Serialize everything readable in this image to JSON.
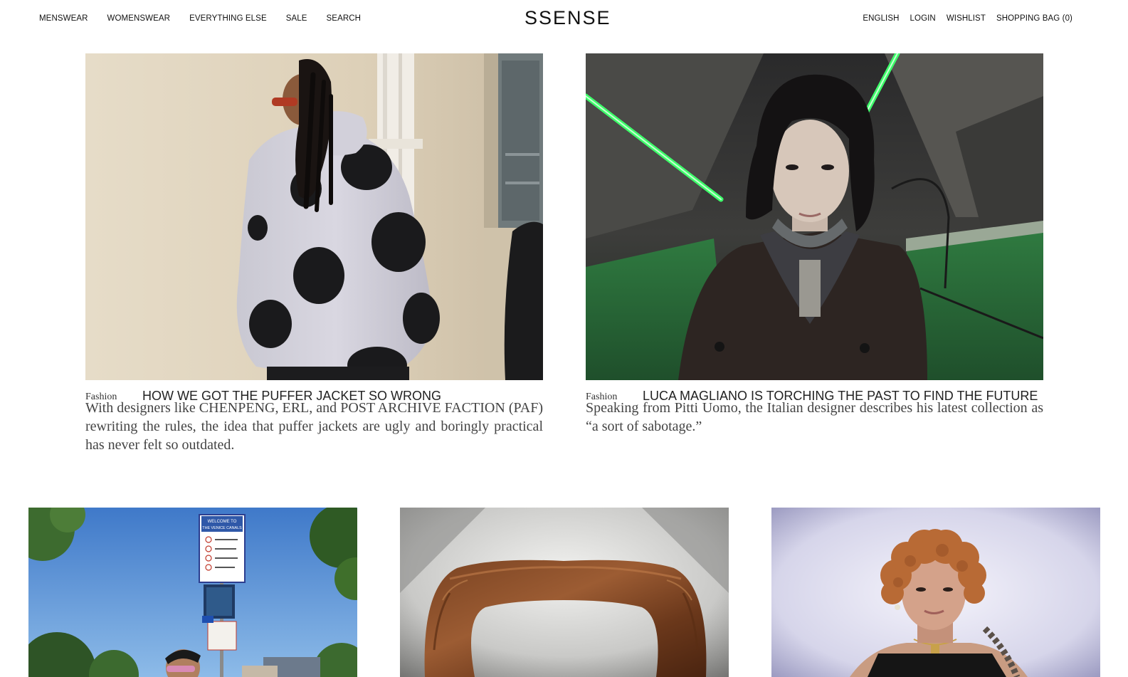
{
  "header": {
    "logo": "SSENSE",
    "nav_left": [
      "MENSWEAR",
      "WOMENSWEAR",
      "EVERYTHING ELSE",
      "SALE",
      "SEARCH"
    ],
    "nav_right": [
      "ENGLISH",
      "LOGIN",
      "WISHLIST",
      "SHOPPING BAG (0)"
    ]
  },
  "features": [
    {
      "category": "Fashion",
      "headline": "HOW WE GOT THE PUFFER JACKET SO WRONG",
      "dek": "With designers like CHENPENG, ERL, and POST ARCHIVE FACTION (PAF) rewriting the rules, the idea that puffer jackets are ugly and boringly practical has never felt so outdated."
    },
    {
      "category": "Fashion",
      "headline": "LUCA MAGLIANO IS TORCHING THE PAST TO FIND THE FUTURE",
      "dek": "Speaking from Pitti Uomo, the Italian designer describes his latest collection as “a sort of sabotage.”"
    }
  ],
  "street_sign": {
    "line1": "WELCOME TO",
    "line2": "THE VENICE CANALS"
  },
  "colors": {
    "text": "#222222",
    "dek": "#444444",
    "background": "#ffffff",
    "neon_green": "#3dff6a"
  }
}
